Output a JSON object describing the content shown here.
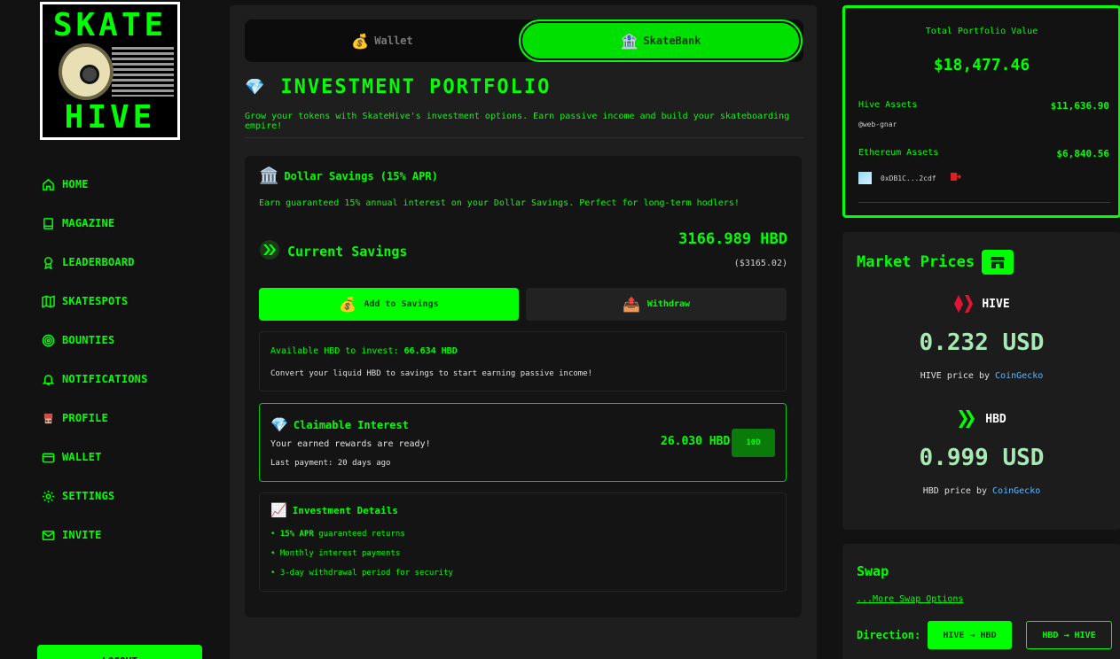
{
  "logo": {
    "top": "SKATE",
    "bottom": "HIVE"
  },
  "nav": [
    {
      "label": "HOME",
      "icon": "home-icon"
    },
    {
      "label": "MAGAZINE",
      "icon": "book-icon"
    },
    {
      "label": "LEADERBOARD",
      "icon": "award-icon"
    },
    {
      "label": "SKATESPOTS",
      "icon": "map-icon"
    },
    {
      "label": "BOUNTIES",
      "icon": "target-icon"
    },
    {
      "label": "NOTIFICATIONS",
      "icon": "bell-icon"
    },
    {
      "label": "PROFILE",
      "icon": "avatar-icon"
    },
    {
      "label": "WALLET",
      "icon": "wallet-icon"
    },
    {
      "label": "SETTINGS",
      "icon": "gear-icon"
    },
    {
      "label": "INVITE",
      "icon": "mail-icon"
    }
  ],
  "logout_label": "LOGOUT",
  "tabs": {
    "wallet": "Wallet",
    "bank": "SkateBank",
    "wallet_emoji": "💰",
    "bank_emoji": "🏦"
  },
  "portfolio_section": {
    "title": "INVESTMENT PORTFOLIO",
    "emoji": "💎",
    "subtitle": "Grow your tokens with SkateHive's investment options. Earn passive income and build your skateboarding empire!"
  },
  "savings": {
    "title": "Dollar Savings (15% APR)",
    "title_emoji": "🏛️",
    "description": "Earn guaranteed 15% annual interest on your Dollar Savings. Perfect for long-term hodlers!",
    "current_label": "Current Savings",
    "amount": "3166.989 HBD",
    "usd": "($3165.02)",
    "add_label": "Add to Savings",
    "add_emoji": "💰",
    "withdraw_label": "Withdraw",
    "withdraw_emoji": "📤",
    "available_prefix": "Available HBD to invest: ",
    "available_amount": "66.634 HBD",
    "available_note": "Convert your liquid HBD to savings to start earning passive income!",
    "claim_title": "Claimable Interest",
    "claim_emoji": "💎",
    "claim_ready": "Your earned rewards are ready!",
    "claim_last": "Last payment: 20 days ago",
    "claim_amount": "26.030 HBD",
    "claim_button": "10D",
    "details_title": "Investment Details",
    "details_emoji": "📈",
    "details": [
      {
        "bold": "15% APR",
        "text": " guaranteed returns"
      },
      {
        "bold": "",
        "text": "Monthly interest payments"
      },
      {
        "bold": "",
        "text": "3-day withdrawal period for security"
      }
    ],
    "bullet": "•"
  },
  "portfolio_value": {
    "title": "Total Portfolio Value",
    "total": "$18,477.46",
    "hive_label": "Hive Assets",
    "hive_value": "$11,636.90",
    "hive_user": "@web-gnar",
    "eth_label": "Ethereum Assets",
    "eth_value": "$6,840.56",
    "eth_address": "0xDB1C...2cdf"
  },
  "market": {
    "title": "Market Prices",
    "hive_name": "HIVE",
    "hive_price": "0.232 USD",
    "hive_by": "HIVE price by ",
    "hbd_name": "HBD",
    "hbd_price": "0.999 USD",
    "hbd_by": "HBD price by ",
    "source": "CoinGecko"
  },
  "swap": {
    "title": "Swap",
    "more": "...More Swap Options",
    "direction": "Direction:",
    "opt1": "HIVE → HBD",
    "opt2": "HBD → HIVE"
  },
  "colors": {
    "accent": "#00ff00",
    "background": "#121212",
    "panel": "#1e1e1e",
    "link": "#5ab8ff",
    "danger": "#ff2a2a"
  }
}
